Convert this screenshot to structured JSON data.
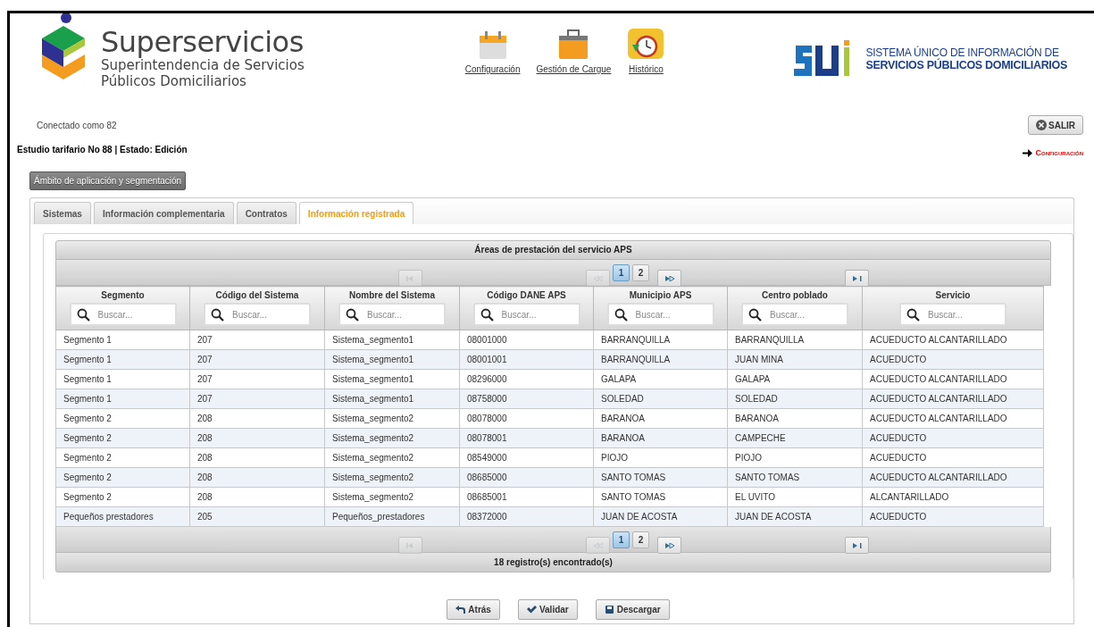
{
  "logo": {
    "name": "Superservicios",
    "subtitle_1": "Superintendencia de Servicios",
    "subtitle_2": "Públicos Domiciliarios"
  },
  "nav": [
    {
      "label": "Configuración",
      "kind": "calendar"
    },
    {
      "label": "Gestión de Cargue",
      "kind": "briefcase"
    },
    {
      "label": "Histórico",
      "kind": "history"
    }
  ],
  "sui_logo": {
    "line_1": "SISTEMA ÚNICO DE INFORMACIÓN DE",
    "line_2": "SERVICIOS PÚBLICOS DOMICILIARIOS"
  },
  "user": "Conectado como 82",
  "logout_button": "SALIR",
  "study": "Estudio tarifario No 88 | Estado: Edición",
  "config_link": "Configuración",
  "section_button": "Ámbito de aplicación y segmentación",
  "tabs": [
    {
      "label": "Sistemas",
      "selected": false
    },
    {
      "label": "Información complementaria",
      "selected": false
    },
    {
      "label": "Contratos",
      "selected": false
    },
    {
      "label": "Información registrada",
      "selected": true
    }
  ],
  "table": {
    "title": "Áreas de prestación del servicio APS",
    "pager_top": {
      "nav": [
        {
          "kind": "first",
          "disabled": true
        },
        {
          "kind": "prev",
          "disabled": true
        },
        {
          "kind": "next",
          "disabled": false
        },
        {
          "kind": "last",
          "disabled": false
        }
      ],
      "pages": [
        {
          "label": "1",
          "selected": true
        },
        {
          "label": "2",
          "selected": false
        }
      ]
    },
    "pager_bottom": {
      "nav": [
        {
          "kind": "first",
          "disabled": true
        },
        {
          "kind": "prev",
          "disabled": true
        },
        {
          "kind": "next",
          "disabled": false
        },
        {
          "kind": "last",
          "disabled": false
        }
      ],
      "pages": [
        {
          "label": "1",
          "selected": true
        },
        {
          "label": "2",
          "selected": false
        }
      ]
    },
    "columns": [
      {
        "label": "Segmento",
        "placeholder": "Buscar..."
      },
      {
        "label": "Código del Sistema",
        "placeholder": "Buscar..."
      },
      {
        "label": "Nombre del Sistema",
        "placeholder": "Buscar..."
      },
      {
        "label": "Código DANE APS",
        "placeholder": "Buscar..."
      },
      {
        "label": "Municipio APS",
        "placeholder": "Buscar..."
      },
      {
        "label": "Centro poblado",
        "placeholder": "Buscar..."
      },
      {
        "label": "Servicio",
        "placeholder": "Buscar..."
      }
    ],
    "rows": [
      [
        "Segmento 1",
        "207",
        "Sistema_segmento1",
        "08001000",
        "BARRANQUILLA",
        "BARRANQUILLA",
        "ACUEDUCTO ALCANTARILLADO"
      ],
      [
        "Segmento 1",
        "207",
        "Sistema_segmento1",
        "08001001",
        "BARRANQUILLA",
        "JUAN MINA",
        "ACUEDUCTO"
      ],
      [
        "Segmento 1",
        "207",
        "Sistema_segmento1",
        "08296000",
        "GALAPA",
        "GALAPA",
        "ACUEDUCTO ALCANTARILLADO"
      ],
      [
        "Segmento 1",
        "207",
        "Sistema_segmento1",
        "08758000",
        "SOLEDAD",
        "SOLEDAD",
        "ACUEDUCTO ALCANTARILLADO"
      ],
      [
        "Segmento 2",
        "208",
        "Sistema_segmento2",
        "08078000",
        "BARANOA",
        "BARANOA",
        "ACUEDUCTO ALCANTARILLADO"
      ],
      [
        "Segmento 2",
        "208",
        "Sistema_segmento2",
        "08078001",
        "BARANOA",
        "CAMPECHE",
        "ACUEDUCTO"
      ],
      [
        "Segmento 2",
        "208",
        "Sistema_segmento2",
        "08549000",
        "PIOJO",
        "PIOJO",
        "ACUEDUCTO"
      ],
      [
        "Segmento 2",
        "208",
        "Sistema_segmento2",
        "08685000",
        "SANTO TOMAS",
        "SANTO TOMAS",
        "ACUEDUCTO ALCANTARILLADO"
      ],
      [
        "Segmento 2",
        "208",
        "Sistema_segmento2",
        "08685001",
        "SANTO TOMAS",
        "EL UVITO",
        "ALCANTARILLADO"
      ],
      [
        "Pequeños prestadores",
        "205",
        "Pequeños_prestadores",
        "08372000",
        "JUAN DE ACOSTA",
        "JUAN DE ACOSTA",
        "ACUEDUCTO"
      ]
    ],
    "footer": "18 registro(s) encontrado(s)"
  },
  "actions": [
    {
      "label": "Atrás",
      "kind": "back"
    },
    {
      "label": "Validar",
      "kind": "check"
    },
    {
      "label": "Descargar",
      "kind": "save"
    }
  ]
}
